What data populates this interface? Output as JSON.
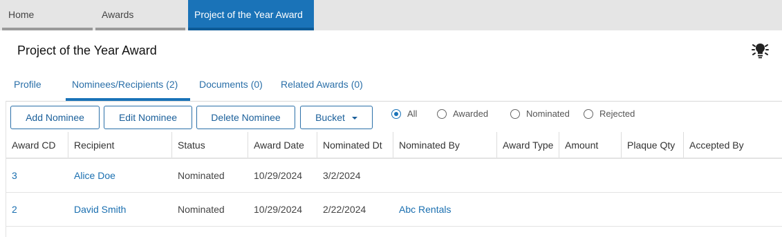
{
  "top_tabs": [
    {
      "label": "Home"
    },
    {
      "label": "Awards"
    },
    {
      "label": "Project of the Year Award"
    }
  ],
  "page": {
    "title": "Project of the Year Award"
  },
  "sub_tabs": [
    {
      "label": "Profile"
    },
    {
      "label": "Nominees/Recipients (2)"
    },
    {
      "label": "Documents (0)"
    },
    {
      "label": "Related Awards (0)"
    }
  ],
  "toolbar": {
    "add_label": "Add Nominee",
    "edit_label": "Edit Nominee",
    "delete_label": "Delete Nominee",
    "bucket_label": "Bucket"
  },
  "filters": [
    {
      "label": "All",
      "selected": true
    },
    {
      "label": "Awarded",
      "selected": false
    },
    {
      "label": "Nominated",
      "selected": false
    },
    {
      "label": "Rejected",
      "selected": false
    }
  ],
  "table": {
    "columns": [
      "Award CD",
      "Recipient",
      "Status",
      "Award Date",
      "Nominated Dt",
      "Nominated By",
      "Award Type",
      "Amount",
      "Plaque Qty",
      "Accepted By"
    ],
    "rows": [
      {
        "award_cd": "3",
        "recipient": "Alice Doe",
        "status": "Nominated",
        "award_date": "10/29/2024",
        "nominated_dt": "3/2/2024",
        "nominated_by": ""
      },
      {
        "award_cd": "2",
        "recipient": "David Smith",
        "status": "Nominated",
        "award_date": "10/29/2024",
        "nominated_dt": "2/22/2024",
        "nominated_by": "Abc Rentals"
      }
    ]
  },
  "colors": {
    "accent": "#1a73b8",
    "link": "#1a6fb0",
    "tab_bar": "#e5e5e5"
  }
}
